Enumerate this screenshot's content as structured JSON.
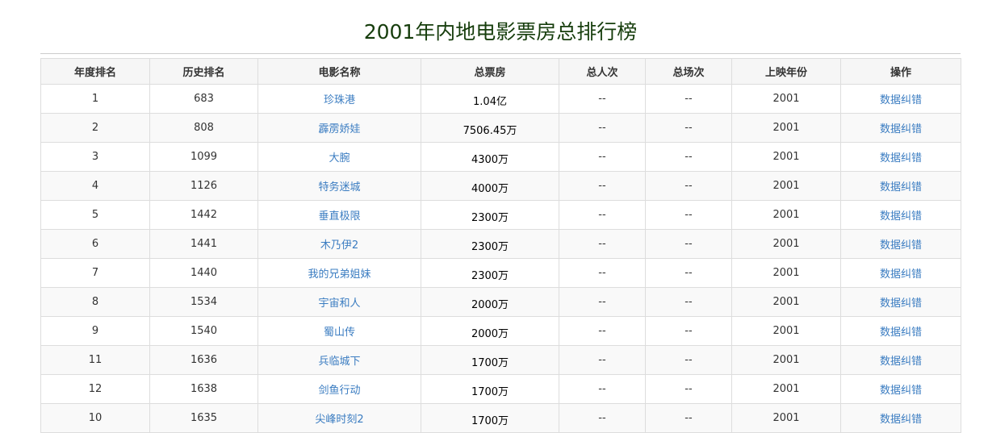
{
  "title": "2001年内地电影票房总排行榜",
  "headers": [
    "年度排名",
    "历史排名",
    "电影名称",
    "总票房",
    "总人次",
    "总场次",
    "上映年份",
    "操作"
  ],
  "rows": [
    {
      "rank": "1",
      "hist": "683",
      "name": "珍珠港",
      "box": "1.04亿",
      "people": "--",
      "shows": "--",
      "year": "2001",
      "op": "数据纠错"
    },
    {
      "rank": "2",
      "hist": "808",
      "name": "霹雳娇娃",
      "box": "7506.45万",
      "people": "--",
      "shows": "--",
      "year": "2001",
      "op": "数据纠错"
    },
    {
      "rank": "3",
      "hist": "1099",
      "name": "大腕",
      "box": "4300万",
      "people": "--",
      "shows": "--",
      "year": "2001",
      "op": "数据纠错"
    },
    {
      "rank": "4",
      "hist": "1126",
      "name": "特务迷城",
      "box": "4000万",
      "people": "--",
      "shows": "--",
      "year": "2001",
      "op": "数据纠错"
    },
    {
      "rank": "5",
      "hist": "1442",
      "name": "垂直极限",
      "box": "2300万",
      "people": "--",
      "shows": "--",
      "year": "2001",
      "op": "数据纠错"
    },
    {
      "rank": "6",
      "hist": "1441",
      "name": "木乃伊2",
      "box": "2300万",
      "people": "--",
      "shows": "--",
      "year": "2001",
      "op": "数据纠错"
    },
    {
      "rank": "7",
      "hist": "1440",
      "name": "我的兄弟姐妹",
      "box": "2300万",
      "people": "--",
      "shows": "--",
      "year": "2001",
      "op": "数据纠错"
    },
    {
      "rank": "8",
      "hist": "1534",
      "name": "宇宙和人",
      "box": "2000万",
      "people": "--",
      "shows": "--",
      "year": "2001",
      "op": "数据纠错"
    },
    {
      "rank": "9",
      "hist": "1540",
      "name": "蜀山传",
      "box": "2000万",
      "people": "--",
      "shows": "--",
      "year": "2001",
      "op": "数据纠错"
    },
    {
      "rank": "11",
      "hist": "1636",
      "name": "兵临城下",
      "box": "1700万",
      "people": "--",
      "shows": "--",
      "year": "2001",
      "op": "数据纠错"
    },
    {
      "rank": "12",
      "hist": "1638",
      "name": "剑鱼行动",
      "box": "1700万",
      "people": "--",
      "shows": "--",
      "year": "2001",
      "op": "数据纠错"
    },
    {
      "rank": "10",
      "hist": "1635",
      "name": "尖峰时刻2",
      "box": "1700万",
      "people": "--",
      "shows": "--",
      "year": "2001",
      "op": "数据纠错"
    }
  ]
}
